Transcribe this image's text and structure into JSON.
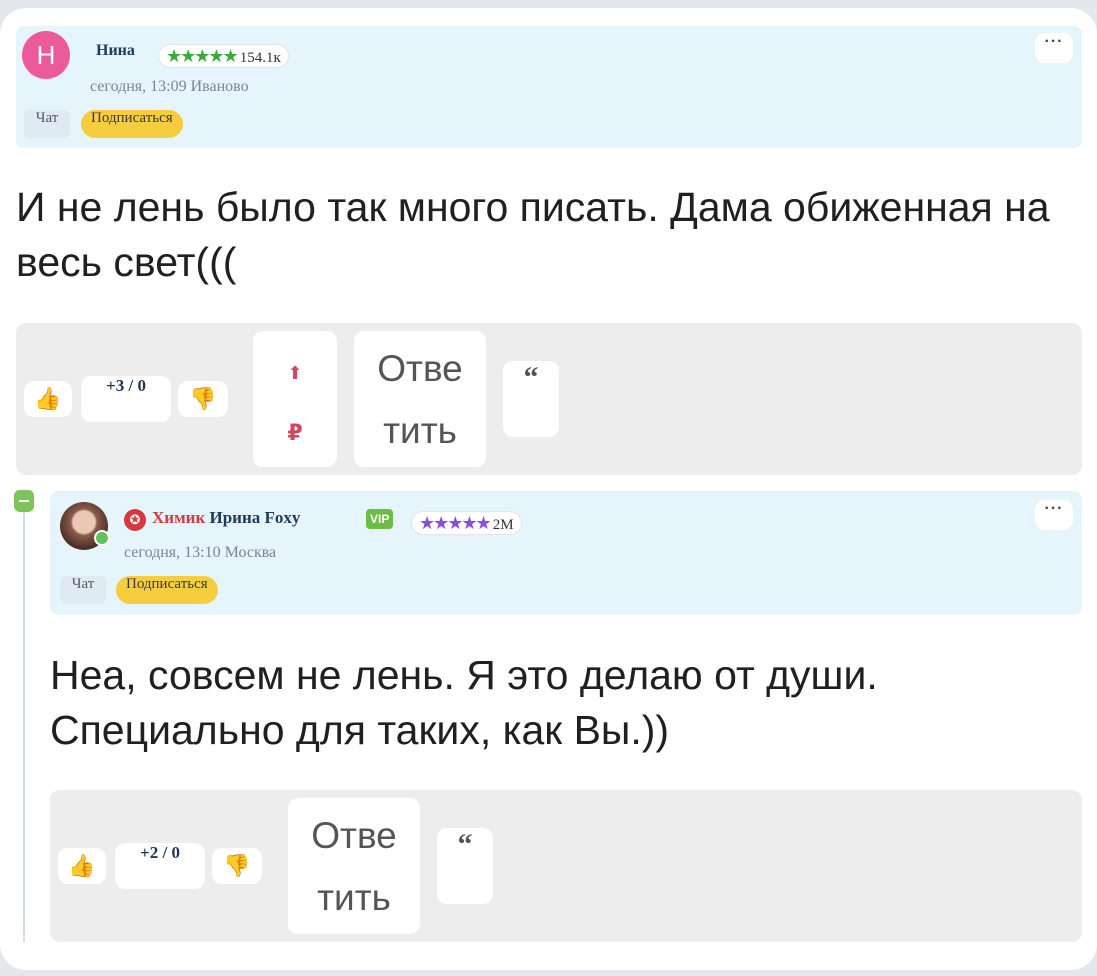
{
  "post": {
    "author_initial": "Н",
    "author": "Нина",
    "stars": "★★★★★",
    "rating": "154.1к",
    "date": "сегодня, 13:09",
    "city": "Иваново",
    "chat_label": "Чат",
    "subscribe_label": "Подписаться",
    "more_label": "···",
    "text": "И не лень было так много писать. Дама обиженная на весь свет(((",
    "score": "+3 / 0",
    "like_icon": "👍",
    "dislike_icon": "👎",
    "tip_arrow": "⬆",
    "tip_currency": "₽",
    "reply_label_1": "Отве",
    "reply_label_2": "тить",
    "quote_label": "“"
  },
  "reply": {
    "role": "Химик",
    "author": "Ирина Foxy",
    "vip": "VIP",
    "stars": "★★★★★",
    "rating": "2М",
    "date": "сегодня, 13:10",
    "city": "Москва",
    "chat_label": "Чат",
    "subscribe_label": "Подписаться",
    "more_label": "···",
    "text": "Неа, совсем не лень. Я это делаю от души. Специально для таких, как Вы.))",
    "score": "+2 / 0",
    "like_icon": "👍",
    "dislike_icon": "👎",
    "reply_label_1": "Отве",
    "reply_label_2": "тить",
    "quote_label": "“"
  },
  "colors": {
    "header_bg": "#e6f4fc",
    "subscribe": "#f6cd3e",
    "stars": "#3aaa3a",
    "role": "#d53a3f",
    "vip": "#6bbd45"
  }
}
